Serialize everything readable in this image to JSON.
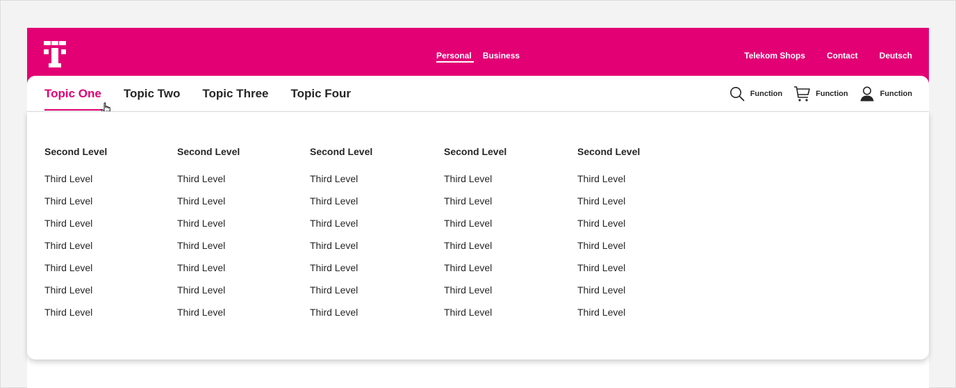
{
  "header": {
    "logo_icon": "telekom-t-logo",
    "brand_color": "#e20074",
    "segments": [
      {
        "label": "Personal",
        "active": true
      },
      {
        "label": "Business",
        "active": false
      }
    ],
    "utility_links": [
      "Telekom Shops",
      "Contact",
      "Deutsch"
    ]
  },
  "main_nav": {
    "topics": [
      {
        "label": "Topic One",
        "active": true
      },
      {
        "label": "Topic Two",
        "active": false
      },
      {
        "label": "Topic Three",
        "active": false
      },
      {
        "label": "Topic Four",
        "active": false
      }
    ],
    "functions": [
      {
        "icon": "search-icon",
        "label": "Function"
      },
      {
        "icon": "cart-icon",
        "label": "Function"
      },
      {
        "icon": "user-icon",
        "label": "Function"
      }
    ]
  },
  "flyout": {
    "columns": [
      {
        "heading": "Second Level",
        "items": [
          "Third Level",
          "Third Level",
          "Third Level",
          "Third Level",
          "Third Level",
          "Third Level",
          "Third Level"
        ]
      },
      {
        "heading": "Second Level",
        "items": [
          "Third Level",
          "Third Level",
          "Third Level",
          "Third Level",
          "Third Level",
          "Third Level",
          "Third Level"
        ]
      },
      {
        "heading": "Second Level",
        "items": [
          "Third Level",
          "Third Level",
          "Third Level",
          "Third Level",
          "Third Level",
          "Third Level",
          "Third Level"
        ]
      },
      {
        "heading": "Second Level",
        "items": [
          "Third Level",
          "Third Level",
          "Third Level",
          "Third Level",
          "Third Level",
          "Third Level",
          "Third Level"
        ]
      },
      {
        "heading": "Second Level",
        "items": [
          "Third Level",
          "Third Level",
          "Third Level",
          "Third Level",
          "Third Level",
          "Third Level",
          "Third Level"
        ]
      }
    ]
  }
}
